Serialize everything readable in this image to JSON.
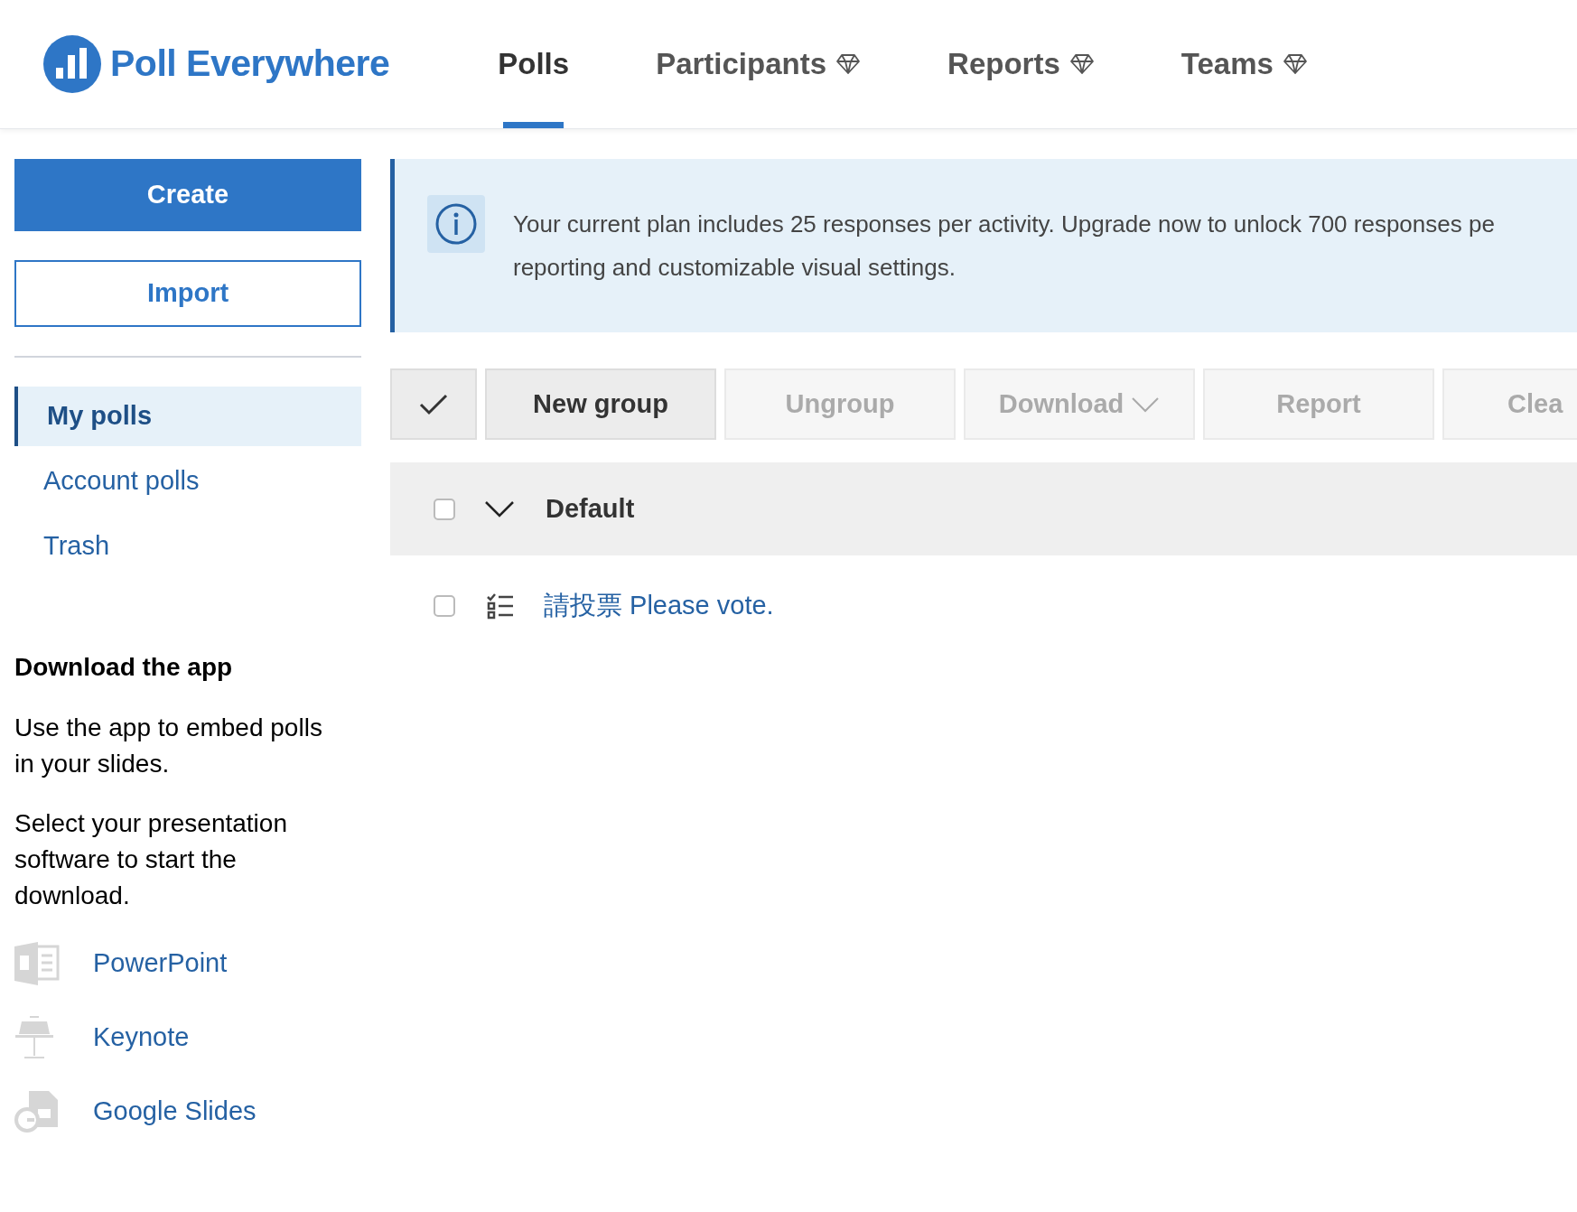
{
  "header": {
    "logo_text": "Poll Everywhere",
    "nav": [
      {
        "label": "Polls",
        "selected": true,
        "premium": false
      },
      {
        "label": "Participants",
        "selected": false,
        "premium": true
      },
      {
        "label": "Reports",
        "selected": false,
        "premium": true
      },
      {
        "label": "Teams",
        "selected": false,
        "premium": true
      }
    ]
  },
  "sidebar": {
    "create_button": "Create",
    "import_button": "Import",
    "items": [
      {
        "label": "My polls",
        "selected": true
      },
      {
        "label": "Account polls",
        "selected": false
      },
      {
        "label": "Trash",
        "selected": false
      }
    ],
    "app_section": {
      "title": "Download the app",
      "paragraphs": [
        "Use the app to embed polls in your slides.",
        "Select your presentation software to start the download."
      ],
      "apps": [
        {
          "kind": "powerpoint",
          "label": "PowerPoint"
        },
        {
          "kind": "keynote",
          "label": "Keynote"
        },
        {
          "kind": "google_slides",
          "label": "Google Slides"
        }
      ]
    }
  },
  "banner": {
    "lines": [
      "Your current plan includes 25 responses per activity. Upgrade now to unlock 700 responses pe",
      "reporting and customizable visual settings."
    ]
  },
  "toolbar": {
    "select_all_checked": true,
    "buttons": [
      {
        "label": "New group",
        "disabled": false,
        "dropdown": false
      },
      {
        "label": "Ungroup",
        "disabled": true,
        "dropdown": false
      },
      {
        "label": "Download",
        "disabled": true,
        "dropdown": true
      },
      {
        "label": "Report",
        "disabled": true,
        "dropdown": false
      },
      {
        "label": "Clea",
        "disabled": true,
        "dropdown": false
      }
    ]
  },
  "groups": [
    {
      "name": "Default",
      "checked": false,
      "expanded": true,
      "polls": [
        {
          "title": "請投票 Please vote.",
          "checked": false
        }
      ]
    }
  ]
}
